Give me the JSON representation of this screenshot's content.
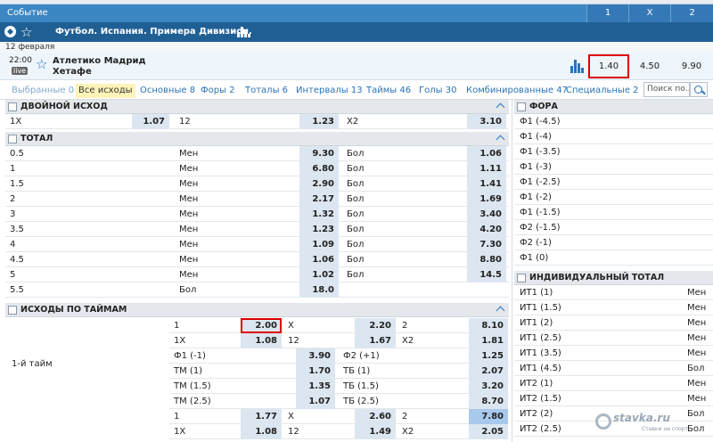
{
  "header": {
    "title": "Событие",
    "cols": [
      "1",
      "X",
      "2"
    ]
  },
  "league": {
    "name": "Футбол. Испания. Примера Дивизион.",
    "icon": "soccer-ball-icon"
  },
  "date": "12 февраля",
  "match": {
    "time": "22:00",
    "live": "live",
    "team1": "Атлетико Мадрид",
    "team2": "Хетафе",
    "odds": [
      "1.40",
      "4.50",
      "9.90"
    ]
  },
  "tabs": [
    {
      "label": "Выбранные",
      "count": "0"
    },
    {
      "label": "Все исходы",
      "count": ""
    },
    {
      "label": "Основные",
      "count": "8"
    },
    {
      "label": "Форы",
      "count": "2"
    },
    {
      "label": "Тоталы",
      "count": "6"
    },
    {
      "label": "Интервалы",
      "count": "13"
    },
    {
      "label": "Таймы",
      "count": "46"
    },
    {
      "label": "Голы",
      "count": "30"
    },
    {
      "label": "Комбинированные",
      "count": "47"
    },
    {
      "label": "Специальные",
      "count": "2"
    }
  ],
  "search": {
    "placeholder": "Поиск по..."
  },
  "double_chance": {
    "title": "ДВОЙНОЙ ИСХОД",
    "row": [
      "1X",
      "1.07",
      "12",
      "1.23",
      "X2",
      "3.10"
    ]
  },
  "total": {
    "title": "ТОТАЛ",
    "rows": [
      [
        "0.5",
        "Мен",
        "9.30",
        "Бол",
        "1.06"
      ],
      [
        "1",
        "Мен",
        "6.80",
        "Бол",
        "1.11"
      ],
      [
        "1.5",
        "Мен",
        "2.90",
        "Бол",
        "1.41"
      ],
      [
        "2",
        "Мен",
        "2.17",
        "Бол",
        "1.69"
      ],
      [
        "3",
        "Мен",
        "1.32",
        "Бол",
        "3.40"
      ],
      [
        "3.5",
        "Мен",
        "1.23",
        "Бол",
        "4.20"
      ],
      [
        "4",
        "Мен",
        "1.09",
        "Бол",
        "7.30"
      ],
      [
        "4.5",
        "Мен",
        "1.06",
        "Бол",
        "8.80"
      ],
      [
        "5",
        "Мен",
        "1.02",
        "Бол",
        "14.5"
      ],
      [
        "5.5",
        "Бол",
        "18.0",
        "",
        ""
      ]
    ]
  },
  "halves": {
    "title": "ИСХОДЫ ПО ТАЙМАМ",
    "period": "1-й тайм",
    "rows": [
      [
        "1",
        "2.00",
        "X",
        "2.20",
        "2",
        "8.10"
      ],
      [
        "1X",
        "1.08",
        "12",
        "1.67",
        "X2",
        "1.81"
      ],
      [
        "Ф1 (-1)",
        "3.90",
        "Ф2 (+1)",
        "1.25"
      ],
      [
        "ТМ (1)",
        "1.70",
        "ТБ (1)",
        "2.07"
      ],
      [
        "ТМ (1.5)",
        "1.35",
        "ТБ (1.5)",
        "3.20"
      ],
      [
        "ТМ (2.5)",
        "1.07",
        "ТБ (2.5)",
        "8.70"
      ],
      [
        "1",
        "1.77",
        "X",
        "2.60",
        "2",
        "7.80"
      ],
      [
        "1X",
        "1.08",
        "12",
        "1.49",
        "X2",
        "2.05"
      ]
    ]
  },
  "handicap": {
    "title": "ФОРА",
    "rows": [
      "Ф1 (-4.5)",
      "Ф1 (-4)",
      "Ф1 (-3.5)",
      "Ф1 (-3)",
      "Ф1 (-2.5)",
      "Ф1 (-2)",
      "Ф1 (-1.5)",
      "Ф2 (-1.5)",
      "Ф2 (-1)",
      "Ф1 (0)"
    ]
  },
  "ind_total": {
    "title": "ИНДИВИДУАЛЬНЫЙ ТОТАЛ",
    "rows": [
      [
        "ИТ1 (1)",
        "Мен"
      ],
      [
        "ИТ1 (1.5)",
        "Мен"
      ],
      [
        "ИТ1 (2)",
        "Мен"
      ],
      [
        "ИТ1 (2.5)",
        "Мен"
      ],
      [
        "ИТ1 (3.5)",
        "Мен"
      ],
      [
        "ИТ1 (4.5)",
        "Бол"
      ],
      [
        "ИТ2 (1)",
        "Мен"
      ],
      [
        "ИТ2 (1.5)",
        "Мен"
      ],
      [
        "ИТ2 (2)",
        "Бол"
      ],
      [
        "ИТ2 (2.5)",
        "Бол"
      ]
    ]
  },
  "watermark": {
    "text": "stavka.ru",
    "sub": "Ставки на спорт"
  },
  "colors": {
    "header": "#3c86c4",
    "league": "#1f5f94",
    "odd_cell": "#dce6f0",
    "highlight": "#d00000"
  }
}
